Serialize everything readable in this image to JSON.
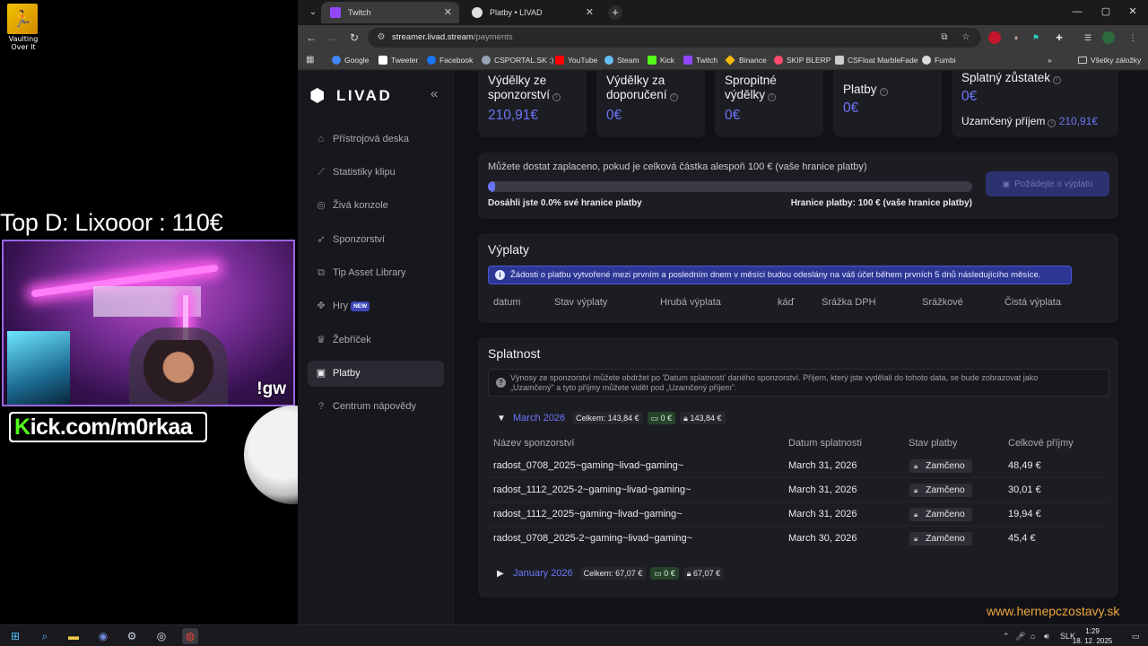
{
  "overlay": {
    "desktop_icon_label": "Vaulting Over It",
    "top_donor": "Top D: Lixooor : 110€",
    "cam_command": "!gw",
    "kick_prefix": "K",
    "kick_text": "ick.com/m0rkaa"
  },
  "browser": {
    "tabs": [
      {
        "title": "Twitch",
        "active": true,
        "favicon_color": "#9146ff"
      },
      {
        "title": "Platby • LIVAD",
        "active": false,
        "favicon_color": "#e0e0e0"
      }
    ],
    "url_host": "streamer.livad.stream",
    "url_path": "/payments",
    "bookmarks": [
      {
        "label": "Google",
        "color": "#4285f4"
      },
      {
        "label": "Tweeter",
        "color": "#ffffff"
      },
      {
        "label": "Facebook",
        "color": "#1877f2"
      },
      {
        "label": "CSPORTAL.SK :)",
        "color": "#9aa4b5"
      },
      {
        "label": "YouTube",
        "color": "#ff0000"
      },
      {
        "label": "Steam",
        "color": "#66c0f4"
      },
      {
        "label": "Kick",
        "color": "#53fc18"
      },
      {
        "label": "Twitch",
        "color": "#9146ff"
      },
      {
        "label": "Binance",
        "color": "#f0b90b"
      },
      {
        "label": "SKIP BLERP",
        "color": "#ff4b6e"
      },
      {
        "label": "CSFloat MarbleFade",
        "color": "#cccccc"
      },
      {
        "label": "Fumbi",
        "color": "#dddddd"
      }
    ],
    "bookmarks_more": "»",
    "all_bookmarks": "Všetky záložky"
  },
  "sidebar": {
    "brand": "LIVAD",
    "items": [
      {
        "label": "Přístrojová deska",
        "icon": "home-icon",
        "glyph": "⌂"
      },
      {
        "label": "Statistiky klipu",
        "icon": "chart-icon",
        "glyph": "⟋"
      },
      {
        "label": "Živá konzole",
        "icon": "target-icon",
        "glyph": "◎"
      },
      {
        "label": "Sponzorství",
        "icon": "rocket-icon",
        "glyph": "➶"
      },
      {
        "label": "Tip Asset Library",
        "icon": "library-icon",
        "glyph": "⧉"
      },
      {
        "label": "Hry",
        "icon": "gamepad-icon",
        "glyph": "✥",
        "badge": "NEW"
      },
      {
        "label": "Žebříček",
        "icon": "trophy-icon",
        "glyph": "♛"
      },
      {
        "label": "Platby",
        "icon": "wallet-icon",
        "glyph": "▣",
        "active": true
      },
      {
        "label": "Centrum nápovědy",
        "icon": "help-icon",
        "glyph": "?"
      }
    ]
  },
  "stats": [
    {
      "label_line1": "Výdělky ze",
      "label_line2": "sponzorství",
      "value": "210,91€"
    },
    {
      "label_line1": "Výdělky za",
      "label_line2": "doporučení",
      "value": "0€"
    },
    {
      "label_line1": "Spropitné",
      "label_line2": "výdělky",
      "value": "0€"
    },
    {
      "label_line1": "",
      "label_line2": "Platby",
      "value": "0€"
    }
  ],
  "balance": {
    "label": "Splatný zůstatek",
    "value": "0€",
    "locked_label": "Uzamčený příjem",
    "locked_value": "210,91€"
  },
  "payout_threshold": {
    "text": "Můžete dostat zaplaceno, pokud je celková částka alespoň 100 € (vaše hranice platby)",
    "progress_fraction": 0.0,
    "reached": "Dosáhli jste 0.0% své hranice platby",
    "limit": "Hranice platby: 100 € (vaše hranice platby)",
    "button": "Požádejte o výplatu"
  },
  "payouts": {
    "title": "Výplaty",
    "notice": "Žádosti o platbu vytvořené mezi prvním a posledním dnem v měsíci budou odeslány na váš účet během prvních 5 dnů následujícího měsíce.",
    "columns": [
      "datum",
      "Stav výplaty",
      "Hrubá výplata",
      "káď",
      "Srážka DPH",
      "Srážkové",
      "Čistá výplata"
    ]
  },
  "maturity": {
    "title": "Splatnost",
    "notice_line1": "Výnosy ze sponzorství můžete obdržet po 'Datum splatnosti' daného sponzorství. Příjem, který jste vydělali do tohoto data, se bude zobrazovat jako",
    "notice_line2": "„Uzamčený\" a tyto příjmy můžete vidět pod „Uzamčený příjem\".",
    "months": [
      {
        "name": "March 2026",
        "expanded": true,
        "total": "Celkem: 143,84 €",
        "paid": "0 €",
        "locked": "143,84 €"
      },
      {
        "name": "January 2026",
        "expanded": false,
        "total": "Celkem: 67,07 €",
        "paid": "0 €",
        "locked": "67,07 €"
      }
    ],
    "columns": [
      "Název sponzorství",
      "Datum splatnosti",
      "Stav platby",
      "Celkové příjmy"
    ],
    "rows": [
      {
        "name": "radost_0708_2025~gaming~livad~gaming~",
        "date": "March 31, 2026",
        "status": "Zamčeno",
        "amount": "48,49 €"
      },
      {
        "name": "radost_1112_2025-2~gaming~livad~gaming~",
        "date": "March 31, 2026",
        "status": "Zamčeno",
        "amount": "30,01 €"
      },
      {
        "name": "radost_1112_2025~gaming~livad~gaming~",
        "date": "March 31, 2026",
        "status": "Zamčeno",
        "amount": "19,94 €"
      },
      {
        "name": "radost_0708_2025-2~gaming~livad~gaming~",
        "date": "March 30, 2026",
        "status": "Zamčeno",
        "amount": "45,4 €"
      }
    ]
  },
  "watermark": "www.hernepczostavy.sk",
  "taskbar": {
    "lang": "SLK",
    "time": "1:29",
    "date": "18. 12. 2025"
  }
}
